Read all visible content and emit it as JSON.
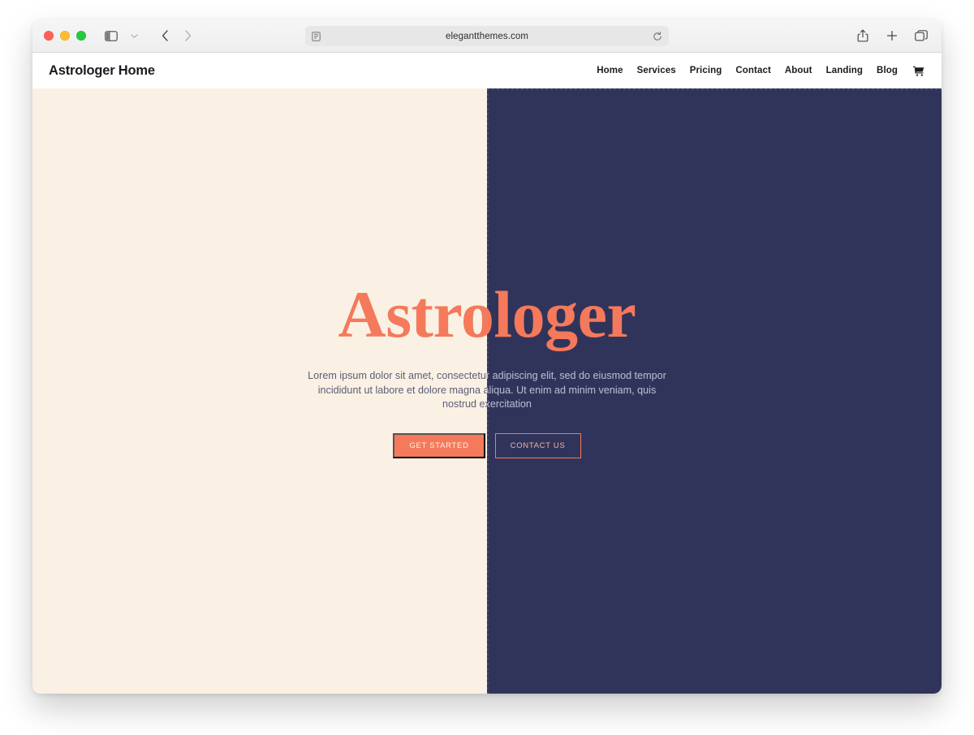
{
  "browser": {
    "url": "elegantthemes.com",
    "traffic_lights": [
      "close",
      "minimize",
      "maximize"
    ],
    "toolbar_icons": {
      "sidebar": "sidebar-icon",
      "sidebar_chevron": "chevron-down-icon",
      "back": "back-arrow-icon",
      "forward": "forward-arrow-icon",
      "shield": "reader-icon",
      "reload": "reload-icon",
      "share": "share-icon",
      "new_tab": "plus-icon",
      "tab_overview": "tab-overview-icon"
    }
  },
  "site": {
    "logo": "Astrologer Home",
    "nav": [
      {
        "label": "Home"
      },
      {
        "label": "Services"
      },
      {
        "label": "Pricing"
      },
      {
        "label": "Contact"
      },
      {
        "label": "About"
      },
      {
        "label": "Landing"
      },
      {
        "label": "Blog"
      }
    ],
    "cart_icon": "shopping-cart-icon",
    "hero": {
      "title": "Astrologer",
      "paragraph": "Lorem ipsum dolor sit amet, consectetur adipiscing elit, sed do eiusmod tempor incididunt ut labore et dolore magna aliqua. Ut enim ad minim veniam, quis nostrud exercitation",
      "primary_button": "GET STARTED",
      "secondary_button": "CONTACT US"
    }
  },
  "colors": {
    "cream": "#faf1e4",
    "navy": "#31345a",
    "coral": "#f5795b",
    "light_text": "#5b5d78",
    "dark_text": "#b9bad0"
  }
}
